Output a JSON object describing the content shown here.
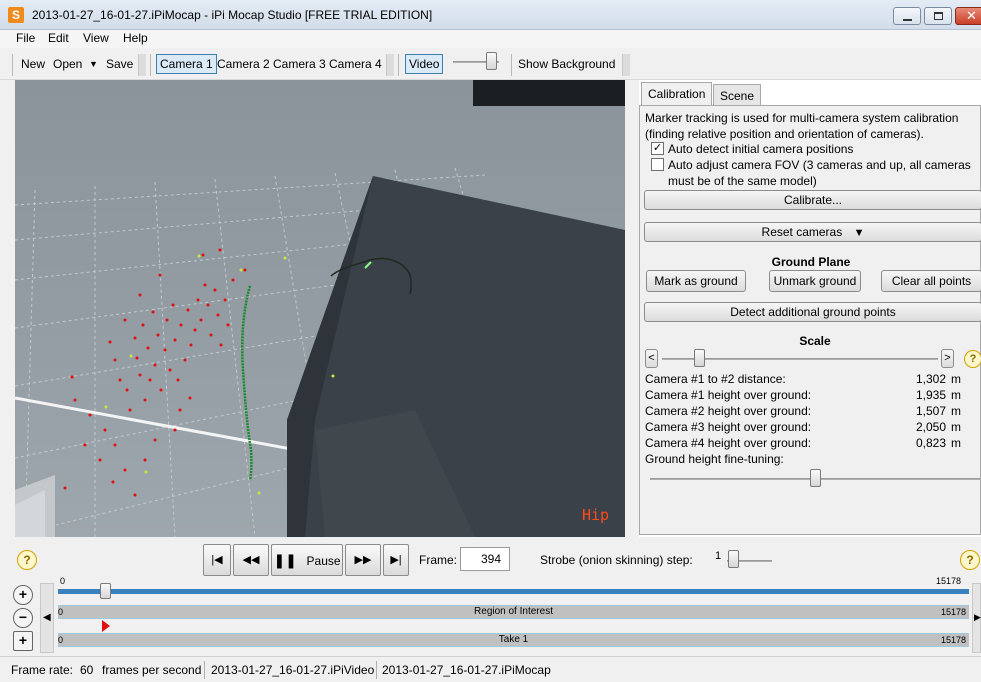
{
  "window": {
    "title": "2013-01-27_16-01-27.iPiMocap - iPi Mocap Studio [FREE TRIAL EDITION]",
    "app_icon_letter": "S"
  },
  "menu": [
    "File",
    "Edit",
    "View",
    "Help"
  ],
  "toolbar": {
    "new_label": "New",
    "open_label": "Open",
    "open_arrow": "▼",
    "save_label": "Save",
    "cameras": [
      "Camera 1",
      "Camera 2",
      "Camera 3",
      "Camera 4"
    ],
    "selected_camera_index": 0,
    "video_label": "Video",
    "video_level": 0.95,
    "show_background_label": "Show Background"
  },
  "viewport": {
    "overlay_label": "Hip"
  },
  "panel": {
    "tabs": [
      "Calibration",
      "Scene"
    ],
    "active_tab": "Calibration",
    "description": "Marker tracking is used for multi-camera system calibration (finding relative position and orientation of cameras).",
    "description_line1": "Marker tracking is used for multi-camera system calibration",
    "description_line2": "(finding relative position and orientation of cameras).",
    "auto_detect_label": "Auto detect initial camera positions",
    "auto_detect_checked": true,
    "auto_detect_mark": "✓",
    "auto_fov_label_line1": "Auto adjust camera FOV (3 cameras and up, all cameras",
    "auto_fov_label_line2": "must be of the same model)",
    "auto_fov_checked": false,
    "calibrate_label": "Calibrate...",
    "reset_cameras_label": "Reset cameras",
    "reset_cameras_arrow": "▼",
    "ground_plane_heading": "Ground Plane",
    "mark_ground_label": "Mark as ground",
    "unmark_ground_label": "Unmark ground",
    "clear_points_label": "Clear all points",
    "detect_ground_label": "Detect additional ground points",
    "scale_heading": "Scale",
    "scale_left_btn": "<",
    "scale_right_btn": ">",
    "scale_level": 0.12,
    "help_mark": "?",
    "measurements": [
      {
        "label": "Camera #1 to #2 distance:",
        "value": "1,302",
        "unit": "m"
      },
      {
        "label": "Camera #1 height over ground:",
        "value": "1,935",
        "unit": "m"
      },
      {
        "label": "Camera #2 height over ground:",
        "value": "1,507",
        "unit": "m"
      },
      {
        "label": "Camera #3 height over ground:",
        "value": "2,050",
        "unit": "m"
      },
      {
        "label": "Camera #4 height over ground:",
        "value": "0,823",
        "unit": "m"
      }
    ],
    "fine_tuning_label": "Ground height fine-tuning:",
    "fine_tuning_level": 0.5
  },
  "player": {
    "help_mark": "?",
    "first_icon": "|◀",
    "rewind_icon": "◀◀",
    "pause_icon": "❚❚",
    "pause_label": "Pause",
    "forward_icon": "▶▶",
    "last_icon": "▶|",
    "frame_label": "Frame:",
    "frame_value": "394",
    "strobe_label": "Strobe (onion skinning) step:",
    "strobe_value": "1"
  },
  "timeline": {
    "start": "0",
    "end": "15178",
    "cursor_frame": 394,
    "region_label": "Region of Interest",
    "region_start": "0",
    "region_end": "15178",
    "take_label": "Take 1",
    "take_start": "0",
    "take_end": "15178",
    "zoom_in": "+",
    "zoom_out": "−",
    "add": "+"
  },
  "status": {
    "frame_rate_label": "Frame rate:",
    "frame_rate_value": "60",
    "frame_rate_unit": "frames per second",
    "video_file": "2013-01-27_16-01-27.iPiVideo",
    "project_file": "2013-01-27_16-01-27.iPiMocap"
  },
  "colors": {
    "accent": "#3a7fc0",
    "marker_red": "#e01010",
    "track_green": "#1a8a2a",
    "hip_label": "#ff4a1a"
  }
}
